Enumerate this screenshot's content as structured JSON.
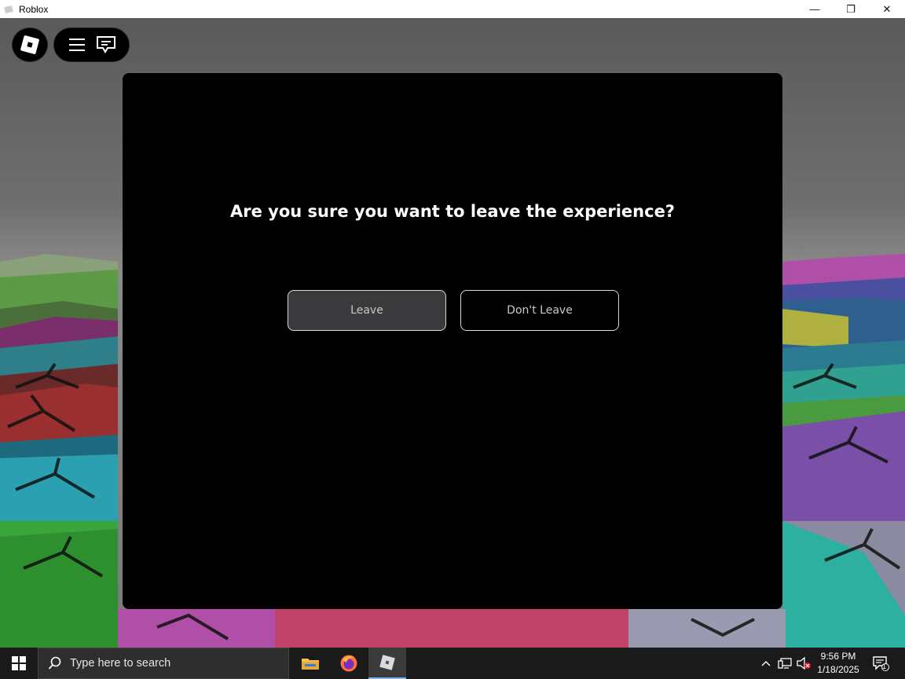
{
  "window": {
    "title": "Roblox",
    "minimize_glyph": "—",
    "restore_glyph": "❐",
    "close_glyph": "✕"
  },
  "hud": {
    "logo_icon": "roblox-logo-icon",
    "menu_icon": "hamburger-menu-icon",
    "chat_icon": "chat-icon"
  },
  "dialog": {
    "question": "Are you sure you want to leave the experience?",
    "leave_label": "Leave",
    "stay_label": "Don't Leave"
  },
  "taskbar": {
    "search_placeholder": "Type here to search",
    "apps": [
      "file-explorer-icon",
      "firefox-icon",
      "roblox-icon"
    ],
    "time": "9:56 PM",
    "date": "1/18/2025",
    "notification_count": "1"
  },
  "colors": {
    "modal_bg": "#000000",
    "leave_bg": "#3a3a3c",
    "taskbar_bg": "#1a1a1a",
    "accent": "#7fb2e5"
  }
}
